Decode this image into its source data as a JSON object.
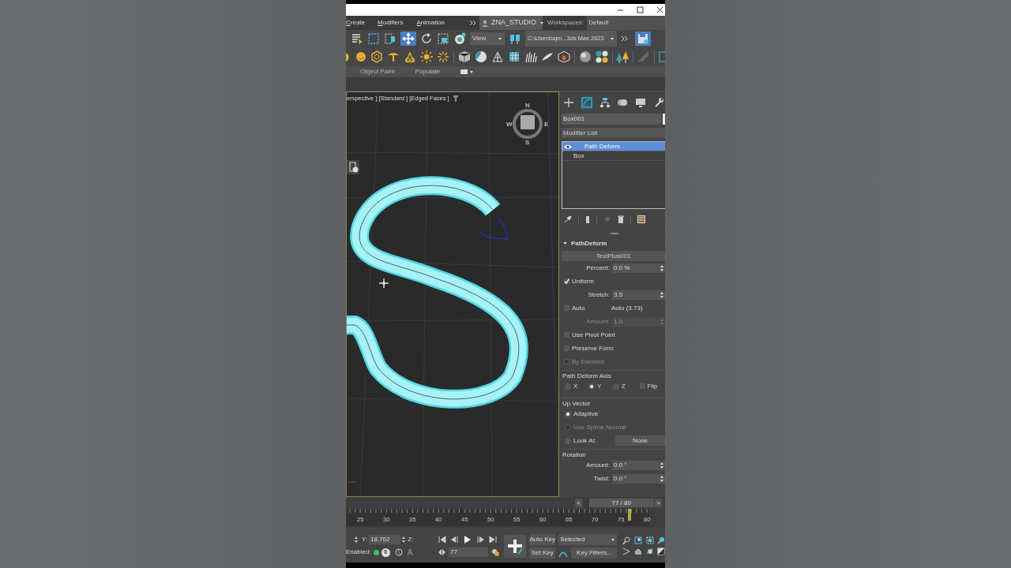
{
  "menu": [
    {
      "label": "Create"
    },
    {
      "label": "Modifiers"
    },
    {
      "label": "Animation"
    }
  ],
  "user": "ZNA_STUDIO",
  "workspaces": {
    "label": "Workspaces:",
    "value": "Default"
  },
  "toolbar": {
    "view": "View",
    "project_path": "C:\\Users\\ajm...3ds Max 2023"
  },
  "ribbon": [
    "Object Paint",
    "Populate"
  ],
  "viewport": {
    "label": "erspective ] [Standard ] [Edged Faces ]",
    "compass": [
      "N",
      "W",
      "E",
      "S"
    ]
  },
  "command_panel": {
    "tabs": [
      {
        "kind": "create",
        "selected": false
      },
      {
        "kind": "modify",
        "selected": true
      },
      {
        "kind": "hierarchy",
        "selected": false
      },
      {
        "kind": "motion",
        "selected": false
      },
      {
        "kind": "display",
        "selected": false
      },
      {
        "kind": "utilities",
        "selected": false
      }
    ],
    "object_name": "Box001",
    "modifier_list": "Modifier List",
    "stack": [
      {
        "label": "Path Deform",
        "kind": "modifier",
        "selected": true
      },
      {
        "label": "Box",
        "kind": "base",
        "selected": false
      }
    ]
  },
  "rollout": {
    "title": "PathDeform",
    "expanded": true,
    "path_button": "TextPlus001",
    "params": [
      {
        "kind": "spinner",
        "label": "Percent:",
        "value": "0.0 %",
        "disabled": false
      },
      {
        "kind": "checkbox",
        "label": "Uniform",
        "checked": true,
        "disabled": false
      },
      {
        "kind": "spinner",
        "label": "Stretch:",
        "value": "3.5",
        "disabled": false
      },
      {
        "kind": "checkbox",
        "label": "Auto",
        "checked": false,
        "disabled": false,
        "note": "Auto (3.73)"
      },
      {
        "kind": "spinner",
        "label": "Amount:",
        "value": "1.0",
        "disabled": true
      },
      {
        "kind": "checkbox",
        "label": "Use Pivot Point",
        "checked": false,
        "disabled": false
      },
      {
        "kind": "checkbox",
        "label": "Preserve Form",
        "checked": false,
        "disabled": false
      },
      {
        "kind": "checkbox",
        "label": "By Element",
        "checked": false,
        "disabled": true
      }
    ],
    "axis": {
      "title": "Path Deform Axis",
      "options": [
        {
          "label": "X",
          "selected": false
        },
        {
          "label": "Y",
          "selected": true
        },
        {
          "label": "Z",
          "selected": false
        }
      ],
      "flip": {
        "label": "Flip",
        "checked": false
      }
    },
    "up_vector": {
      "title": "Up Vector",
      "options": [
        {
          "label": "Adaptive",
          "selected": true,
          "disabled": false
        },
        {
          "label": "Use Spline Normal",
          "selected": false,
          "disabled": true
        },
        {
          "label": "Look At:",
          "selected": false,
          "disabled": false,
          "button": "None"
        }
      ]
    },
    "rotation": {
      "title": "Rotation",
      "spinners": [
        {
          "label": "Amount:",
          "value": "0.0 °"
        },
        {
          "label": "Twist:",
          "value": "0.0 °"
        }
      ]
    }
  },
  "time_slider": {
    "prev": "<",
    "value": "77 / 80",
    "next": ">",
    "level": 0.96
  },
  "timeline": {
    "ticks": [
      "25",
      "30",
      "35",
      "40",
      "45",
      "50",
      "55",
      "60",
      "65",
      "70",
      "75",
      "80"
    ]
  },
  "status": {
    "y_label": "Y:",
    "y_value": "18.762",
    "z_label": "Z:",
    "enabled_label": "Enabled:",
    "enabled": true,
    "count": "0",
    "frame": "77",
    "auto_key": "Auto Key",
    "key_mode": "Selected",
    "set_key": "Set Key",
    "key_filters": "Key Filters..."
  }
}
